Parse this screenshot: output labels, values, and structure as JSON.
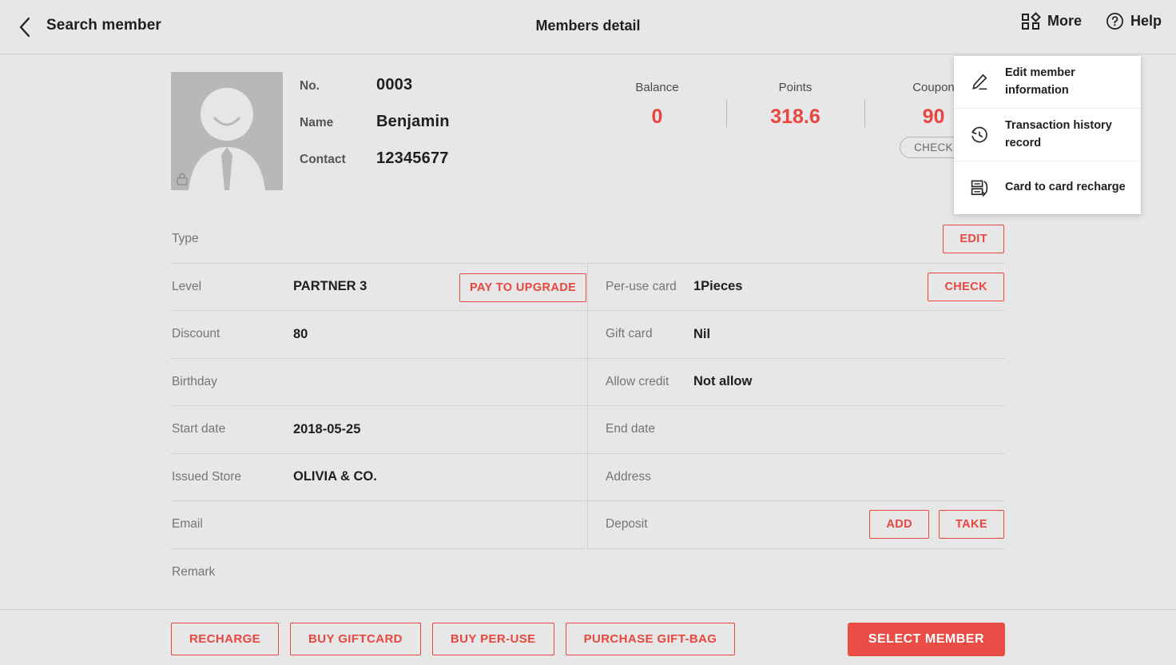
{
  "header": {
    "back_label": "Search member",
    "title": "Members detail",
    "more_label": "More",
    "help_label": "Help",
    "back_icon": "chevron-left-icon",
    "more_icon": "grid-more-icon",
    "help_icon": "question-circle-icon"
  },
  "more_menu": {
    "items": [
      {
        "label": "Edit member information",
        "icon": "pencil-edit-icon"
      },
      {
        "label": "Transaction history record",
        "icon": "clock-history-icon"
      },
      {
        "label": "Card to card recharge",
        "icon": "card-transfer-icon"
      }
    ]
  },
  "member": {
    "avatar_icon": "person-placeholder-avatar",
    "lock_icon": "lock-icon",
    "fields": [
      {
        "label": "No.",
        "value": "0003"
      },
      {
        "label": "Name",
        "value": "Benjamin"
      },
      {
        "label": "Contact",
        "value": "12345677"
      }
    ]
  },
  "stats": [
    {
      "label": "Balance",
      "value": "0"
    },
    {
      "label": "Points",
      "value": "318.6"
    },
    {
      "label": "Coupon",
      "value": "90",
      "action": "CHECK"
    }
  ],
  "detail_rows": [
    {
      "left": {
        "label": "Type",
        "value": ""
      },
      "right": {
        "label": "",
        "value": "",
        "buttons": [
          "EDIT"
        ]
      }
    },
    {
      "left": {
        "label": "Level",
        "value": "PARTNER 3",
        "inline_button": "PAY TO UPGRADE"
      },
      "right": {
        "label": "Per-use card",
        "value": "1Pieces",
        "buttons": [
          "CHECK"
        ]
      }
    },
    {
      "left": {
        "label": "Discount",
        "value": "80"
      },
      "right": {
        "label": "Gift card",
        "value": "Nil"
      }
    },
    {
      "left": {
        "label": "Birthday",
        "value": ""
      },
      "right": {
        "label": "Allow credit",
        "value": "Not allow"
      }
    },
    {
      "left": {
        "label": "Start date",
        "value": "2018-05-25"
      },
      "right": {
        "label": "End date",
        "value": ""
      }
    },
    {
      "left": {
        "label": "Issued Store",
        "value": "OLIVIA & CO."
      },
      "right": {
        "label": "Address",
        "value": ""
      }
    },
    {
      "left": {
        "label": "Email",
        "value": ""
      },
      "right": {
        "label": "Deposit",
        "value": "",
        "buttons": [
          "ADD",
          "TAKE"
        ]
      }
    },
    {
      "left": {
        "label": "Remark",
        "value": ""
      },
      "right": {
        "label": "",
        "value": ""
      }
    }
  ],
  "footer": {
    "actions": [
      "RECHARGE",
      "BUY GIFTCARD",
      "BUY PER-USE",
      "PURCHASE GIFT-BAG"
    ],
    "primary": "SELECT MEMBER"
  },
  "colors": {
    "accent_red": "#e8463f",
    "primary_fill": "#ea4c46",
    "background": "#e7e7e7",
    "divider": "#d3d3d3",
    "label_grey": "#757575"
  }
}
